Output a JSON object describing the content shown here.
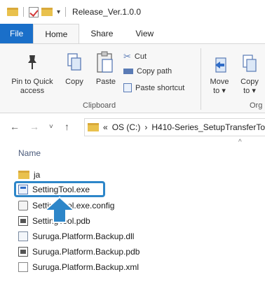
{
  "window": {
    "title": "Release_Ver.1.0.0"
  },
  "tabs": [
    "File",
    "Home",
    "Share",
    "View"
  ],
  "ribbon": {
    "pin_label_line1": "Pin to Quick",
    "pin_label_line2": "access",
    "copy_label": "Copy",
    "paste_label": "Paste",
    "cut_label": "Cut",
    "copy_path_label": "Copy path",
    "paste_shortcut_label": "Paste shortcut",
    "clipboard_group": "Clipboard",
    "move_label": "Move",
    "move_sub": "to",
    "copy_to_label": "Copy",
    "copy_to_sub": "to",
    "organize_group": "Org"
  },
  "address": {
    "prefix": "«",
    "drive": "OS (C:)",
    "separator": "›",
    "path": "H410-Series_SetupTransferTo"
  },
  "file_list": {
    "column_name": "Name",
    "items": [
      {
        "name": "ja",
        "icon": "folder-icon"
      },
      {
        "name": "SettingTool.exe",
        "icon": "exe-icon"
      },
      {
        "name": "SettingTool.exe.config",
        "icon": "config-icon"
      },
      {
        "name": "SettingTool.pdb",
        "icon": "pdb-icon"
      },
      {
        "name": "Suruga.Platform.Backup.dll",
        "icon": "dll-icon"
      },
      {
        "name": "Suruga.Platform.Backup.pdb",
        "icon": "pdb-icon"
      },
      {
        "name": "Suruga.Platform.Backup.xml",
        "icon": "xml-icon"
      }
    ]
  },
  "colors": {
    "accent": "#1a6fc9",
    "highlight": "#2d86c9",
    "folder": "#e9c14d"
  }
}
